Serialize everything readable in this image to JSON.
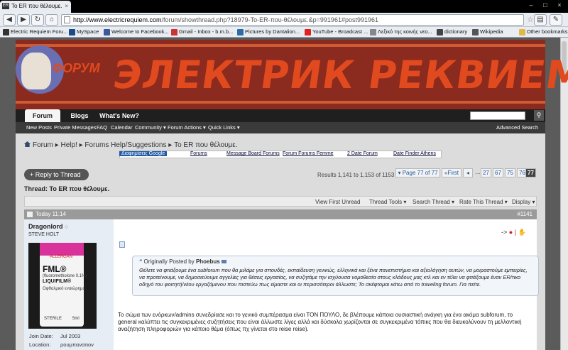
{
  "browser": {
    "tab_title": "Το ER που θέλουμε.",
    "tab_icon": "ER",
    "url_domain": "http://www.electricrequiem.com",
    "url_path": "/forum/showthread.php?18979-Το-ER-που-θέλουμε.&p=991961#post991961",
    "bookmarks": [
      "Electric Requiem Foru...",
      "MySpace",
      "Welcome to Facebook...",
      "Gmail - Inbox - b.m.b...",
      "Pictures by Dantalion...",
      "YouTube - Broadcast ...",
      "Λεξικό της κοινής νεο...",
      "dictionary",
      "Wikipedia",
      "Other bookmarks"
    ]
  },
  "banner": {
    "title": "ЭЛЕКТРИК РЕКВИЕМ",
    "tag": "ФОРУМ",
    "accent": "#e04a1e",
    "background": "#8b2a1e"
  },
  "nav": {
    "tabs": [
      "Forum",
      "Blogs",
      "What's New?"
    ],
    "subnav": [
      "New Posts",
      "Private Messages",
      "FAQ",
      "Calendar",
      "Community ▾",
      "Forum Actions ▾",
      "Quick Links ▾"
    ],
    "advanced_search": "Advanced Search"
  },
  "breadcrumb": [
    "Forum",
    "Help!",
    "Forums Help/Suggestions",
    "Το ER που θέλουμε."
  ],
  "ads": [
    "Διαφημίσεις Google",
    "Forums",
    "Message Board Forums",
    "Forum Forums Femme",
    "2 Date Forum",
    "Date Finder Athens"
  ],
  "thread": {
    "reply_label": "+ Reply to Thread",
    "results": "Results 1,141 to 1,153 of 1153",
    "page_label": "▾ Page 77 of 77",
    "first_label": "First",
    "prev_label": "◂",
    "pages": [
      "...",
      "27",
      "67",
      "75",
      "76",
      "77"
    ],
    "title_prefix": "Thread:",
    "title": "Το ER που θέλουμε.",
    "tools": [
      "View First Unread",
      "Thread Tools ▾",
      "Search Thread ▾",
      "Rate This Thread ▾",
      "Display ▾"
    ]
  },
  "post": {
    "date": "Today 11:14",
    "number": "#1141",
    "username": "Dragonlord",
    "user_title": "STEVE HOLT",
    "avatar": {
      "brand": "ALLERGAN",
      "name": "FML®",
      "generic": "(fluorometholone 0.1%)",
      "line": "LIQUIFILM®",
      "greek": "Οφθαλμικό εναιώρημα",
      "volume": "5ml",
      "lot": "STERILE"
    },
    "join_label": "Join Date:",
    "join_value": "Jul 2003",
    "location_label": "Location:",
    "location_value": "ρουμπανατιον",
    "quote_intro": "Originally Posted by",
    "quote_author": "Phoebus",
    "quote_text": "Θέλετε να φτιάξουμε ένα subforum που θα μιλάμε για σπουδές, εκπαίδευση γενικώς, ελληνικά και ξένα πανεπιστήμια και αξιολόγηση αυτών, να μοιραστούμε εμπειρίες, να προτείνουμε, να δημοσιεύουμε αγγελίες για θέσεις εργασίας, να συζητάμε την ισχύουσα νομοθεσία στους κλάδους μας κτλ και εν τέλει να φτιάξουμε έναν ER/τικο οδηγό του φοιτητή/νέου εργαζόμενου που πιστεύω πως είμαστε και οι περισσότεροι άλλωστε; Το σκέφτομαι κάτω από το traveling forum. Για πείτε.",
    "body": "Το σώμα των ενόρκων/admins συνεδρίασε και το γενικό συμπέρασμα είναι ΤΟΝ ΠΟΥΛΟ, δε βλέπουμε κάποια ουσιαστική ανάγκη για ένα ακόμα subforum, το general καλύπτει τις συγκεκριμένες συζητήσεις που είναι άλλωστε λίγες αλλά και δύσκολα χωρίζονται σε συγκεκριμένα τόπικς που θα διευκολύνουν τη μελλοντική αναζήτηση πληροφοριών για κάποιο θέμα (όπως πχ γίνεται στο reise reise).",
    "rep_arrow": "->"
  }
}
